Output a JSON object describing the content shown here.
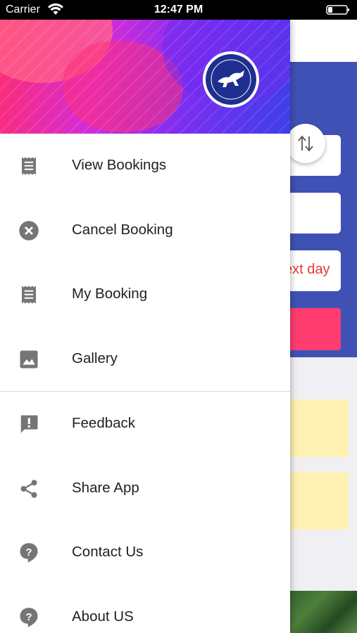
{
  "status_bar": {
    "carrier": "Carrier",
    "time": "12:47 PM"
  },
  "background": {
    "date_hint": "ext day",
    "colors": {
      "blue": "#3f51b5",
      "search_button": "#ff3d71",
      "card": "#fff0b3"
    }
  },
  "drawer": {
    "header_icons": {
      "logo": "emblem-logo-icon"
    },
    "section1": [
      {
        "label": "View Bookings",
        "icon": "receipt-icon"
      },
      {
        "label": "Cancel Booking",
        "icon": "cancel-icon"
      },
      {
        "label": "My Booking",
        "icon": "receipt-icon"
      },
      {
        "label": "Gallery",
        "icon": "image-icon"
      }
    ],
    "section2": [
      {
        "label": "Feedback",
        "icon": "feedback-icon"
      },
      {
        "label": "Share App",
        "icon": "share-icon"
      },
      {
        "label": "Contact Us",
        "icon": "help-icon"
      },
      {
        "label": "About US",
        "icon": "help-icon"
      }
    ]
  }
}
